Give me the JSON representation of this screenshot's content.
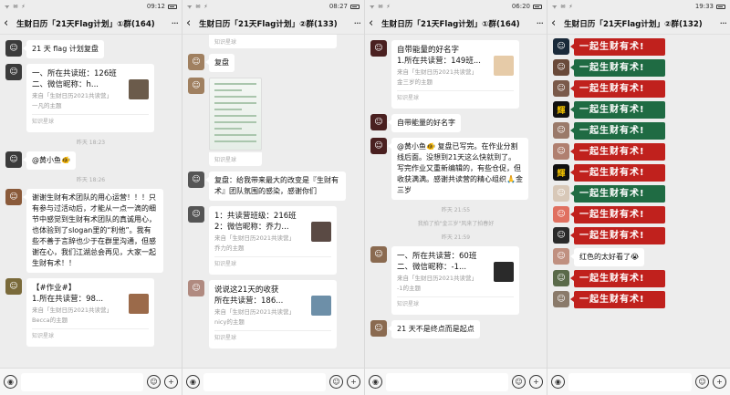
{
  "panels": [
    {
      "status": {
        "left": "ᯤ ✉ ⚡",
        "time": "09:12"
      },
      "title": "生财日历「21天Flag计划」①群(164)",
      "messages": {
        "m1": "21 天 flag 计划复盘",
        "m2_line1": "一、所在共读班：126班",
        "m2_line2": "二、微信昵称：h...",
        "m2_src": "来自「生财日历2021共读营」",
        "m2_author": "一凡的主题",
        "m2_foot": "知识星球",
        "time1": "昨天 18:23",
        "m3": "@黄小鱼🐠",
        "time2": "昨天 18:26",
        "m4": "谢谢生财有术团队的用心运营！！！只有参与过活动后，才能从一点一滴的细节中感觉到生财有术团队的真诚用心，也体验到了slogan里的“利他”。我有些不善于言辞也少于在群里沟通，但感谢在心，我们江湖总会再见，大家一起生财有术！！",
        "m5_line1": "【#作业#】",
        "m5_line2": "1.所在共读营：98...",
        "m5_src": "来自「生财日历2021共读营」",
        "m5_author": "Becca的主题",
        "m5_foot": "知识星球"
      }
    },
    {
      "status": {
        "left": "ᯤ ✉ ⚡",
        "time": "08:27"
      },
      "title": "生财日历「21天Flag计划」②群(133)",
      "messages": {
        "top_foot": "知识星球",
        "m1": "复盘",
        "m2_foot": "知识星球",
        "m3": "复盘：给我带来最大的改变是『生财有术』团队氛围的感染，感谢你们",
        "m4_line1": "1：共读营班级：216班",
        "m4_line2": "2：微信昵称：乔力...",
        "m4_src": "来自「生财日历2021共读营」",
        "m4_author": "乔力的主题",
        "m4_foot": "知识星球",
        "m5_line1": "说说这21天的收获",
        "m5_line2": "所在共读营：186...",
        "m5_src": "来自「生财日历2021共读营」",
        "m5_author": "nicy的主题",
        "m5_foot": "知识星球"
      }
    },
    {
      "status": {
        "left": "ᯤ ✉ ⚡",
        "time": "06:20"
      },
      "title": "生财日历「21天Flag计划」①群(164)",
      "messages": {
        "m1_line1": "自带能量的好名字",
        "m1_line2": "1.所在共读营：149班...",
        "m1_src": "来自「生财日历2021共读营」",
        "m1_author": "金三岁的主题",
        "m1_foot": "知识星球",
        "m2": "自带能量的好名字",
        "m3": "@黄小鱼🐠 复盘已写完。在作业分割线后面。没想到21天这么快就到了。写完作业又重新编辑的，有些仓促，但收获满满。感谢共读营的精心组织🙏金三岁",
        "time1": "昨天 21:55",
        "sys": "我拍了拍\"金三岁\"风来了拍春好",
        "time2": "昨天 21:59",
        "m4_line1": "一、所在共读营：60班",
        "m4_line2": "二、微信昵称：-1...",
        "m4_src": "来自「生财日历2021共读营」",
        "m4_author": "-1的主题",
        "m4_foot": "知识星球",
        "m5": "21 天不是终点而是起点"
      }
    },
    {
      "status": {
        "left": "ᯤ ✉ ⚡",
        "time": "19:33"
      },
      "title": "生财日历「21天Flag计划」②群(132)",
      "slogan": "一起生财有术!",
      "emoji_reply": "红色的太好看了😭"
    }
  ],
  "input": {
    "voice": "◉",
    "emoji": "☺",
    "plus": "+"
  },
  "colors": {
    "red": "#c0211d",
    "green": "#1f6b43",
    "bg": "#ededed"
  }
}
